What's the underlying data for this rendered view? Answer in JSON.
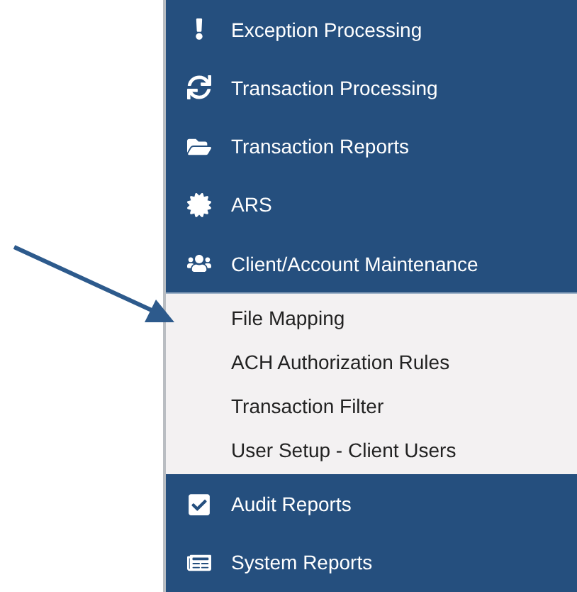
{
  "menu": [
    {
      "label": "Exception Processing"
    },
    {
      "label": "Transaction Processing"
    },
    {
      "label": "Transaction Reports"
    },
    {
      "label": "ARS"
    },
    {
      "label": "Client/Account Maintenance",
      "expanded": true,
      "children": [
        {
          "label": "File Mapping"
        },
        {
          "label": "ACH Authorization Rules"
        },
        {
          "label": "Transaction Filter"
        },
        {
          "label": "User Setup - Client Users"
        }
      ]
    },
    {
      "label": "Audit Reports"
    },
    {
      "label": "System Reports"
    }
  ]
}
